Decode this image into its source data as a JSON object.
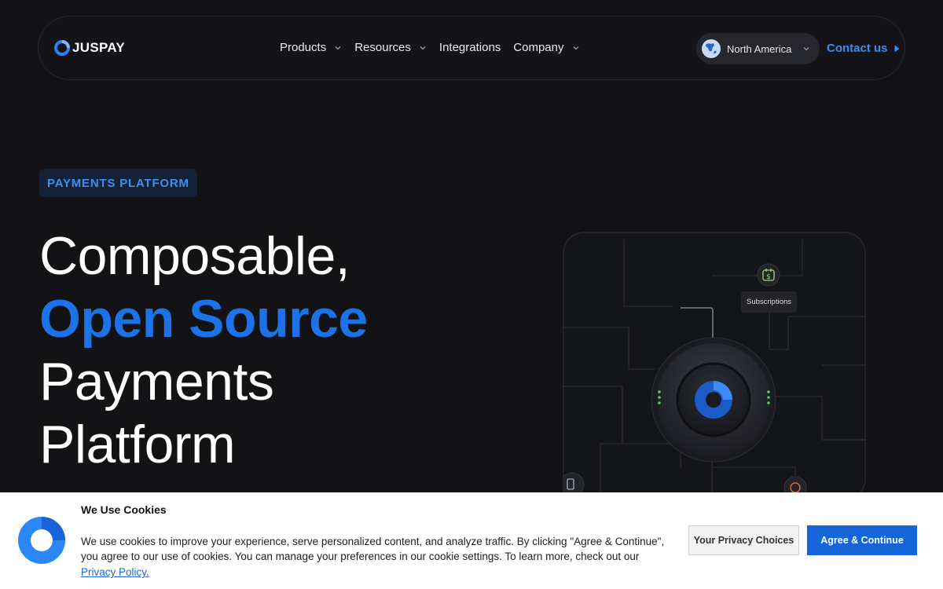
{
  "nav": {
    "brand": "JUSPAY",
    "menu": [
      {
        "label": "Products",
        "has_dropdown": true
      },
      {
        "label": "Resources",
        "has_dropdown": true
      },
      {
        "label": "Integrations",
        "has_dropdown": false
      },
      {
        "label": "Company",
        "has_dropdown": true
      }
    ],
    "region": "North America",
    "contact": "Contact us"
  },
  "hero": {
    "badge": "PAYMENTS PLATFORM",
    "line1": "Composable,",
    "line2": "Open Source",
    "line3": "Payments",
    "line4": "Platform"
  },
  "illustration": {
    "tag": "Subscriptions"
  },
  "cookie": {
    "title": "We Use Cookies",
    "text": "We use cookies to improve your experience, serve personalized content, and analyze traffic. By clicking \"Agree & Continue\", you agree to our use of cookies. You can manage your preferences in our cookie settings. To learn more, check out our",
    "link": "Privacy Policy.",
    "btn_choices": "Your Privacy Choices",
    "btn_agree": "Agree & Continue"
  },
  "colors": {
    "background": "#131316",
    "accent": "#1c72e6",
    "link": "#3a8cf0",
    "agree_button": "#1565d8"
  }
}
